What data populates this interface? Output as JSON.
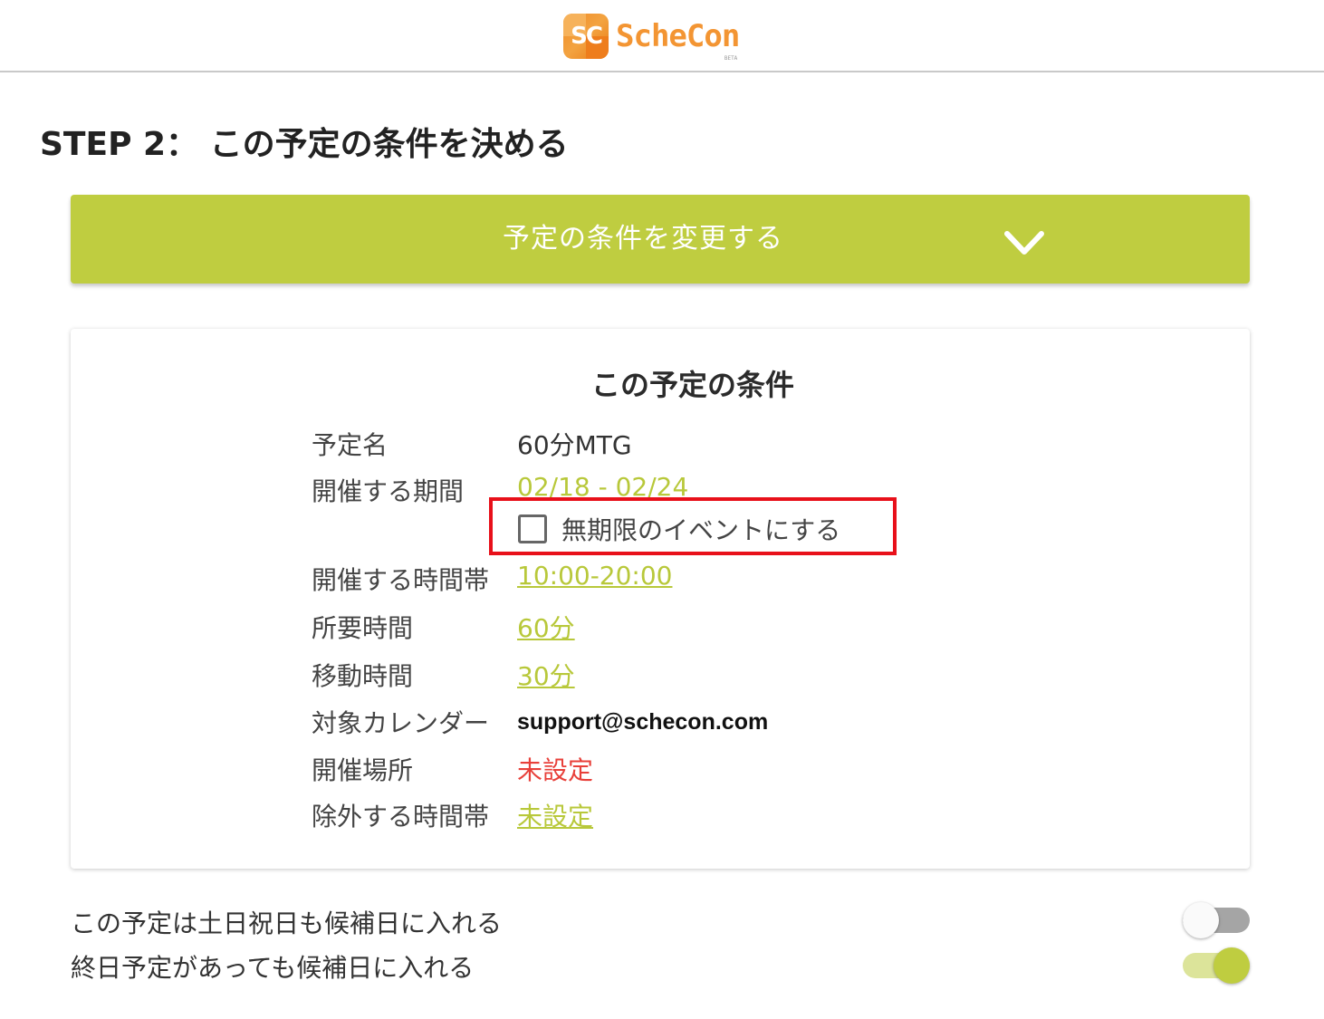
{
  "header": {
    "logo_mark_letters": "SC",
    "logo_text": "ScheCon",
    "logo_badge": "BETA"
  },
  "step_title": "STEP 2： この予定の条件を決める",
  "change_button": {
    "label": "予定の条件を変更する",
    "icon": "chevron-down-icon"
  },
  "conditions": {
    "title": "この予定の条件",
    "event_name": {
      "label": "予定名",
      "value": "60分MTG"
    },
    "period": {
      "label": "開催する期間",
      "value": "02/18 - 02/24"
    },
    "indefinite_checkbox": {
      "label": "無期限のイベントにする",
      "checked": false
    },
    "time_window": {
      "label": "開催する時間帯",
      "value": "10:00-20:00"
    },
    "duration": {
      "label": "所要時間",
      "value": "60分"
    },
    "travel_time": {
      "label": "移動時間",
      "value": "30分"
    },
    "calendar": {
      "label": "対象カレンダー",
      "value": "support@schecon.com"
    },
    "location": {
      "label": "開催場所",
      "value": "未設定"
    },
    "excluded_time": {
      "label": "除外する時間帯",
      "value": "未設定"
    }
  },
  "toggles": {
    "include_weekends": {
      "label": "この予定は土日祝日も候補日に入れる",
      "on": false
    },
    "include_all_day": {
      "label": "終日予定があっても候補日に入れる",
      "on": true
    }
  },
  "colors": {
    "accent": "#bfcd40",
    "link": "#b8c83a",
    "unset_red": "#e8403a",
    "highlight_red": "#e8101a",
    "logo_orange": "#f39533"
  }
}
